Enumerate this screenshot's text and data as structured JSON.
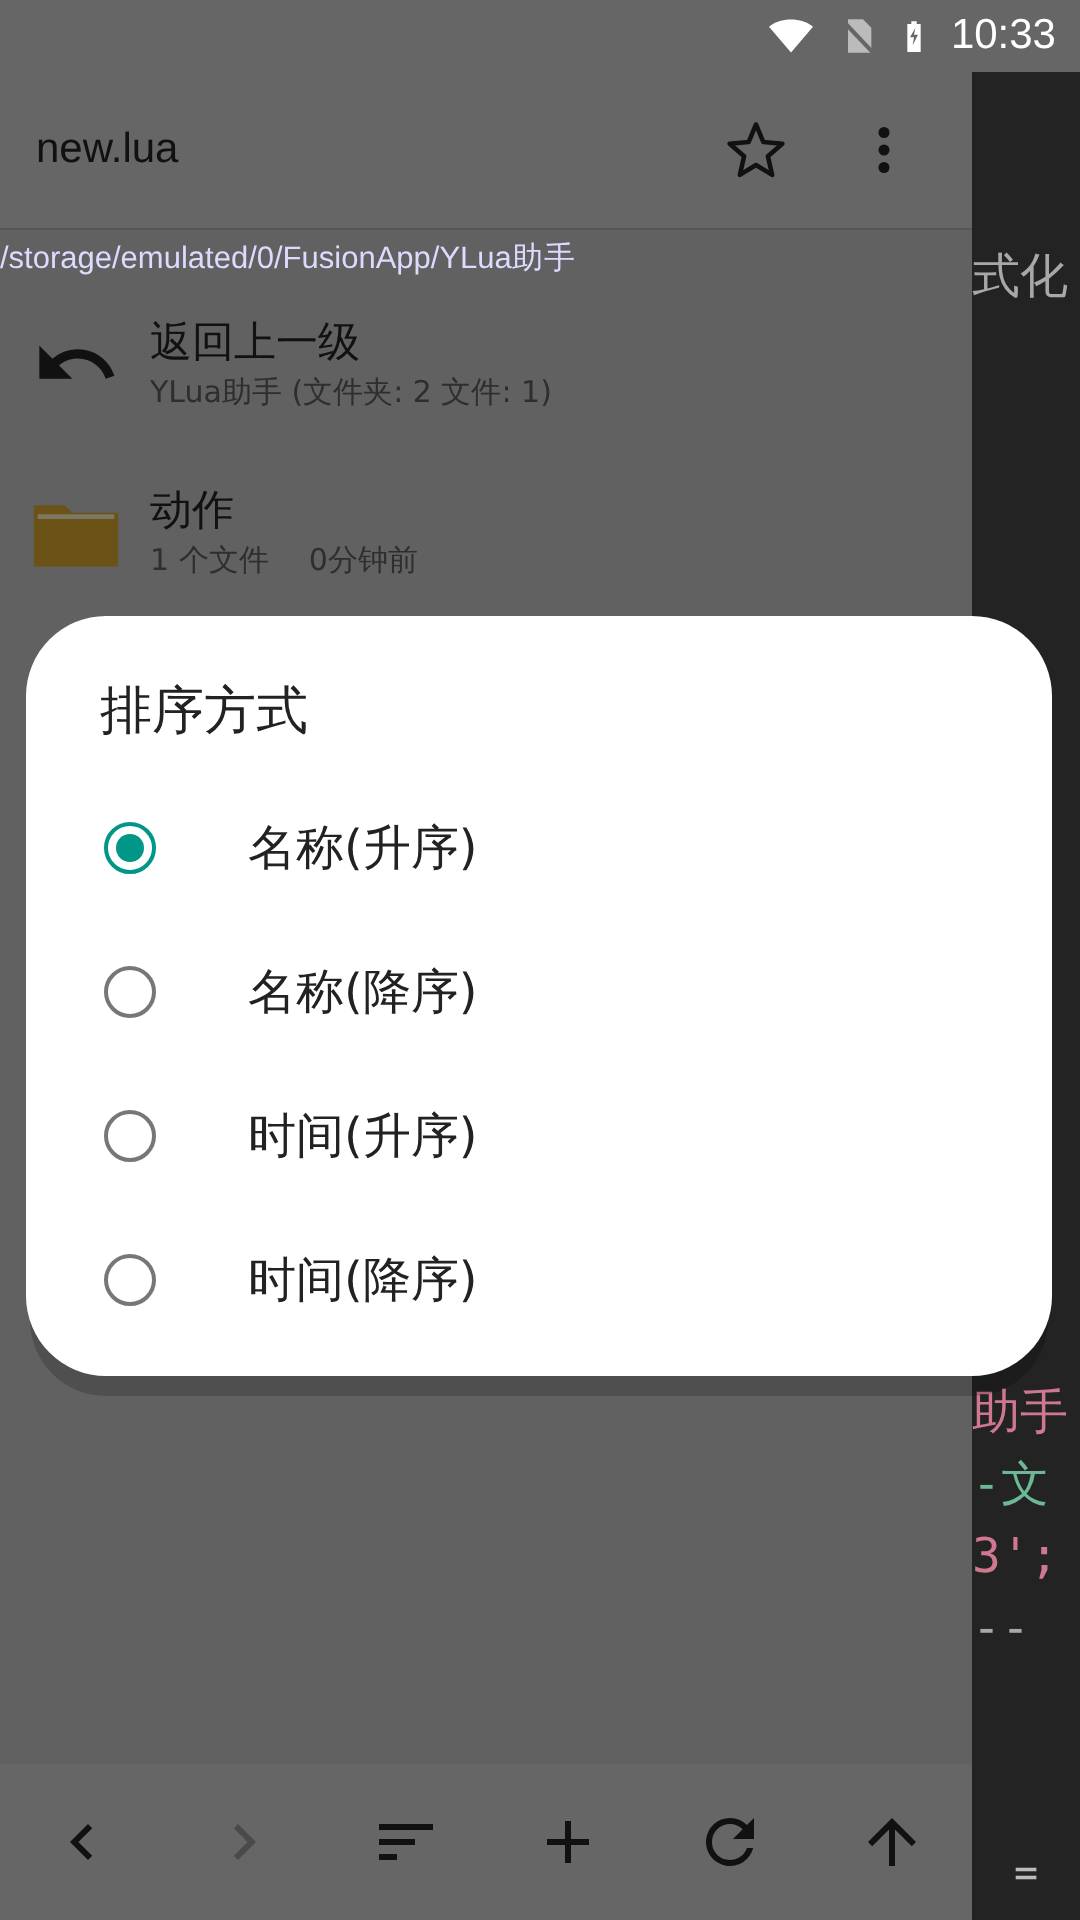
{
  "status_bar": {
    "time": "10:33"
  },
  "toolbar": {
    "title": "new.lua"
  },
  "path": "/storage/emulated/0/FusionApp/YLua助手",
  "files": [
    {
      "kind": "up",
      "name": "返回上一级",
      "detail": "YLua助手 (文件夹: 2 文件: 1)"
    },
    {
      "kind": "folder",
      "name": "动作",
      "detail": "1 个文件",
      "time": "0分钟前"
    }
  ],
  "bottom_bar": [
    {
      "kind": "back",
      "disabled": false
    },
    {
      "kind": "forward",
      "disabled": true
    },
    {
      "kind": "sort",
      "disabled": false
    },
    {
      "kind": "add",
      "disabled": false
    },
    {
      "kind": "refresh",
      "disabled": false
    },
    {
      "kind": "up",
      "disabled": false
    }
  ],
  "editor": {
    "lines": [
      {
        "kind": "plain",
        "text": "式化"
      },
      {
        "kind": "string",
        "text": "助手"
      },
      {
        "kind": "comment",
        "text": "-文"
      },
      {
        "kind": "string",
        "text": "3';"
      },
      {
        "kind": "plain",
        "text": "--"
      }
    ],
    "key": "="
  },
  "dialog": {
    "title": "排序方式",
    "options": [
      {
        "label": "名称(升序)",
        "selected": true
      },
      {
        "label": "名称(降序)",
        "selected": false
      },
      {
        "label": "时间(升序)",
        "selected": false
      },
      {
        "label": "时间(降序)",
        "selected": false
      }
    ]
  }
}
